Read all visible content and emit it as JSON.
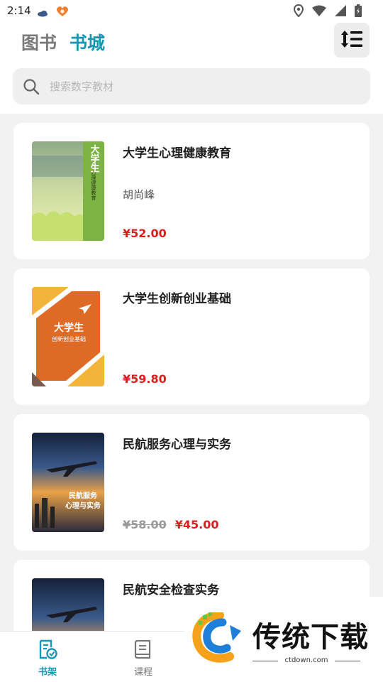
{
  "status_bar": {
    "time": "2:14"
  },
  "header": {
    "tab_books": "图书",
    "tab_store": "书城"
  },
  "search": {
    "placeholder": "搜索数字教材"
  },
  "books": [
    {
      "title": "大学生心理健康教育",
      "author": "胡尚峰",
      "price": "¥52.00",
      "original_price": ""
    },
    {
      "title": "大学生创新创业基础",
      "author": "",
      "price": "¥59.80",
      "original_price": ""
    },
    {
      "title": "民航服务心理与实务",
      "author": "",
      "price": "¥45.00",
      "original_price": "¥58.00"
    },
    {
      "title": "民航安全检查实务",
      "author": "",
      "price": "",
      "original_price": ""
    }
  ],
  "covers": {
    "cover1": {
      "title": "大学生",
      "subtitle": "心理健康教育"
    },
    "cover2": {
      "title": "大学生",
      "subtitle": "创新创业基础"
    },
    "cover3": {
      "title": "民航服务",
      "subtitle": "心理与实务"
    }
  },
  "bottom_nav": {
    "shelf": "书架",
    "course": "课程"
  },
  "watermark": {
    "text": "传统下载",
    "url": "ctdown.com"
  },
  "colors": {
    "accent": "#1796b2",
    "price": "#d81e1e",
    "strike": "#9a9a9a"
  }
}
